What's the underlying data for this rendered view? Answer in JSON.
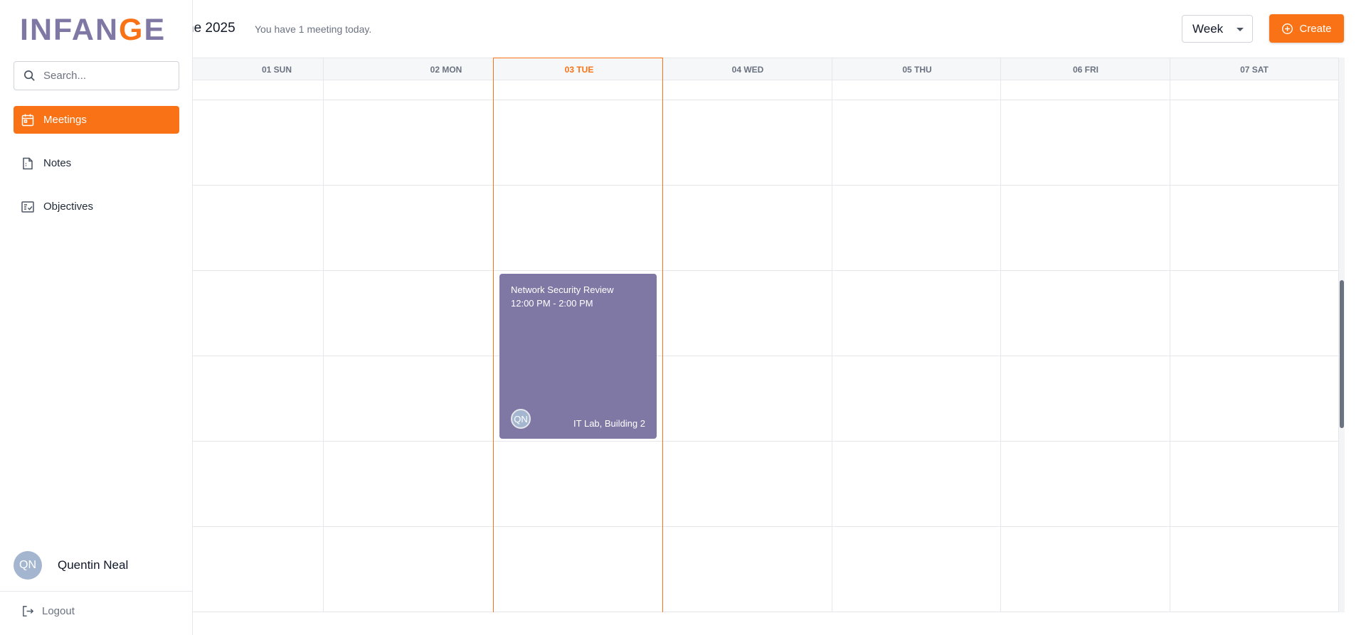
{
  "header": {
    "month_title": "ne 2025",
    "meeting_count": "You have 1 meeting today.",
    "view_select": "Week",
    "create_label": "Create"
  },
  "sidebar": {
    "logo_left": "INFAN",
    "logo_accent": "G",
    "logo_right": "E",
    "search_placeholder": "Search...",
    "nav": [
      {
        "label": "Meetings",
        "icon": "calendar-icon",
        "active": true
      },
      {
        "label": "Notes",
        "icon": "note-icon",
        "active": false
      },
      {
        "label": "Objectives",
        "icon": "checklist-icon",
        "active": false
      }
    ],
    "user": {
      "initials": "QN",
      "name": "Quentin Neal"
    },
    "logout_label": "Logout"
  },
  "calendar": {
    "days": [
      {
        "label": "01 SUN",
        "today": false
      },
      {
        "label": "02 MON",
        "today": false
      },
      {
        "label": "03 TUE",
        "today": true
      },
      {
        "label": "04 WED",
        "today": false
      },
      {
        "label": "05 THU",
        "today": false
      },
      {
        "label": "06 FRI",
        "today": false
      },
      {
        "label": "07 SAT",
        "today": false
      }
    ],
    "events": [
      {
        "title": "Network Security Review",
        "time": "12:00 PM - 2:00 PM",
        "attendee_initials": "QN",
        "location": "IT Lab, Building 2",
        "day": "03 TUE"
      }
    ]
  },
  "colors": {
    "accent": "#f97316",
    "brand": "#7f78a5",
    "event_bg": "#7f78a5",
    "avatar_bg": "#a4b6cf"
  }
}
